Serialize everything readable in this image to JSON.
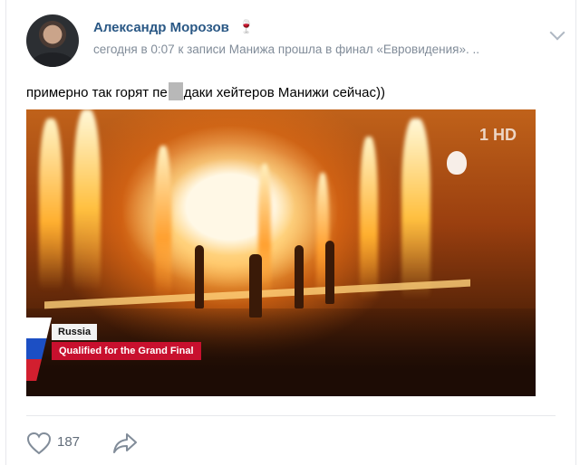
{
  "post": {
    "author_name": "Александр Морозов",
    "author_badge": "🍷",
    "meta_prefix": "сегодня в 0:07 к записи ",
    "meta_link": "Манижа прошла в финал «Евровидения». ..",
    "text_before": "примерно так горят пе",
    "text_after": "даки хейтеров Манижи сейчас))"
  },
  "media": {
    "country_label": "Russia",
    "qualified_label": "Qualified for the Grand Final",
    "channel_logo": "1 HD"
  },
  "actions": {
    "like_icon": "heart-outline-icon",
    "like_count": "187",
    "share_icon": "share-arrow-icon"
  },
  "colors": {
    "author_link": "#2a5885",
    "meta_gray": "#818c99",
    "banner_red": "#c8102e"
  }
}
